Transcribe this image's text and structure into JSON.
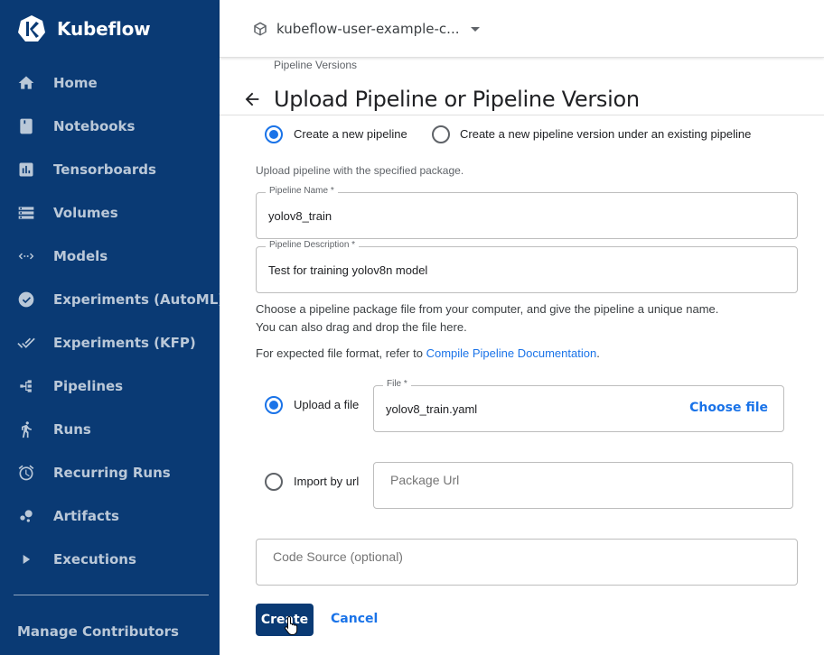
{
  "brand": {
    "name": "Kubeflow",
    "logo_icon": "kubeflow-logo-icon"
  },
  "sidebar": {
    "items": [
      {
        "label": "Home",
        "icon": "home-icon"
      },
      {
        "label": "Notebooks",
        "icon": "notebook-icon"
      },
      {
        "label": "Tensorboards",
        "icon": "tensorboard-icon"
      },
      {
        "label": "Volumes",
        "icon": "storage-icon"
      },
      {
        "label": "Models",
        "icon": "code-arrows-icon"
      },
      {
        "label": "Experiments (AutoML)",
        "icon": "experiment-automl-icon"
      },
      {
        "label": "Experiments (KFP)",
        "icon": "done-all-icon"
      },
      {
        "label": "Pipelines",
        "icon": "pipeline-icon"
      },
      {
        "label": "Runs",
        "icon": "running-icon"
      },
      {
        "label": "Recurring Runs",
        "icon": "alarm-icon"
      },
      {
        "label": "Artifacts",
        "icon": "bubbles-icon"
      },
      {
        "label": "Executions",
        "icon": "play-arrow-icon"
      }
    ],
    "manage_contributors": "Manage Contributors"
  },
  "topbar": {
    "namespace": "kubeflow-user-example-c...",
    "namespace_icon": "cube-icon"
  },
  "page": {
    "breadcrumb": "Pipeline Versions",
    "title": "Upload Pipeline or Pipeline Version",
    "mode_options": [
      {
        "label": "Create a new pipeline",
        "checked": true
      },
      {
        "label": "Create a new pipeline version under an existing pipeline",
        "checked": false
      }
    ],
    "upload_hint": "Upload pipeline with the specified package.",
    "pipeline_name": {
      "label": "Pipeline Name *",
      "value": "yolov8_train"
    },
    "pipeline_description": {
      "label": "Pipeline Description *",
      "value": "Test for training yolov8n model"
    },
    "instructions": {
      "line1": "Choose a pipeline package file from your computer, and give the pipeline a unique name.",
      "line2": "You can also drag and drop the file here.",
      "format_prefix": "For expected file format, refer to ",
      "format_link": "Compile Pipeline Documentation",
      "format_suffix": "."
    },
    "source_options": {
      "upload": {
        "label": "Upload a file",
        "checked": true
      },
      "url": {
        "label": "Import by url",
        "checked": false
      }
    },
    "file_field": {
      "label": "File *",
      "value": "yolov8_train.yaml",
      "choose_label": "Choose file"
    },
    "package_url": {
      "placeholder": "Package Url"
    },
    "code_source": {
      "placeholder": "Code Source (optional)"
    },
    "actions": {
      "create": "Create",
      "cancel": "Cancel"
    }
  },
  "colors": {
    "sidebar_bg": "#0a3a74",
    "accent": "#1a73e8",
    "primary_button": "#0a3a74"
  }
}
